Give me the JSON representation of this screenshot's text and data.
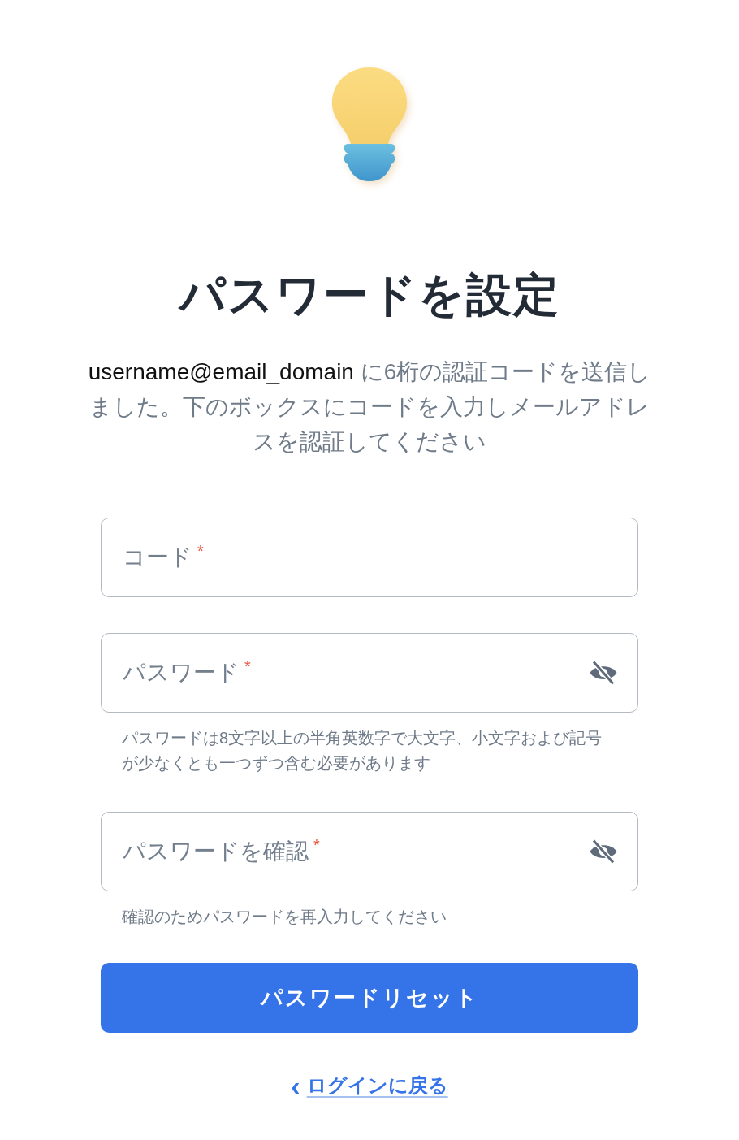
{
  "title": "パスワードを設定",
  "description": {
    "email": "username@email_domain",
    "message": "に6桁の認証コードを送信しました。下のボックスにコードを入力しメールアドレスを認証してください"
  },
  "fields": [
    {
      "kind": "code",
      "placeholder": "コード",
      "required_mark": "*"
    },
    {
      "kind": "password",
      "placeholder": "パスワード",
      "required_mark": "*",
      "password_visible": false,
      "help": "パスワードは8文字以上の半角英数字で大文字、小文字および記号が少なくとも一つずつ含む必要があります"
    },
    {
      "kind": "password",
      "placeholder": "パスワードを確認",
      "required_mark": "*",
      "password_visible": false,
      "help": "確認のためパスワードを再入力してください"
    }
  ],
  "submit_button": "パスワードリセット",
  "back_link": {
    "icon": "‹",
    "label": "ログインに戻る"
  }
}
